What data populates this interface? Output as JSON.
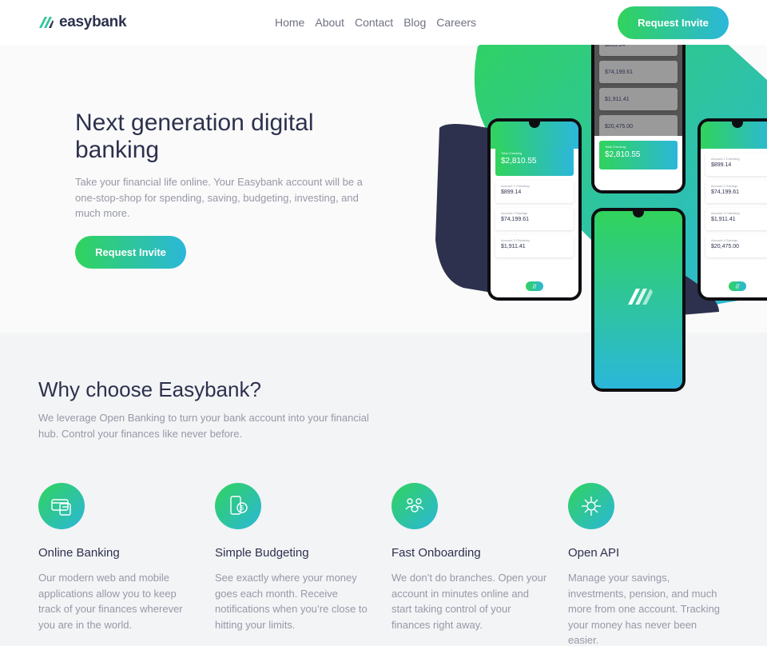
{
  "header": {
    "logo_text": "easybank",
    "nav": [
      "Home",
      "About",
      "Contact",
      "Blog",
      "Careers"
    ],
    "cta": "Request Invite"
  },
  "hero": {
    "title": "Next generation digital banking",
    "text": "Take your financial life online. Your Easybank account will be a one-stop-shop for spending, saving, budgeting, investing, and much more.",
    "cta": "Request Invite"
  },
  "phones": {
    "total_label": "Total Checking",
    "total_value": "$2,810.55",
    "accounts": [
      {
        "label": "Account 1 Checking",
        "value": "$899.14"
      },
      {
        "label": "Account 2 Savings",
        "value": "$74,199.61"
      },
      {
        "label": "Account 3 Checking",
        "value": "$1,911.41"
      },
      {
        "label": "Account 4 Savings",
        "value": "$20,475.00"
      }
    ]
  },
  "features": {
    "title": "Why choose Easybank?",
    "text": "We leverage Open Banking to turn your bank account into your financial hub. Control your finances like never before.",
    "items": [
      {
        "title": "Online Banking",
        "text": "Our modern web and mobile applications allow you to keep track of your finances wherever you are in the world.",
        "icon": "online-banking-icon"
      },
      {
        "title": "Simple Budgeting",
        "text": "See exactly where your money goes each month. Receive notifications when you’re close to hitting your limits.",
        "icon": "budgeting-icon"
      },
      {
        "title": "Fast Onboarding",
        "text": "We don’t do branches. Open your account in minutes online and start taking control of your finances right away.",
        "icon": "onboarding-icon"
      },
      {
        "title": "Open API",
        "text": "Manage your savings, investments, pension, and much more from one account. Tracking your money has never been easier.",
        "icon": "api-icon"
      }
    ]
  },
  "colors": {
    "dark_blue": "#2d314d",
    "lime_green": "#31d35c",
    "bright_cyan": "#2bb7da",
    "grayish_blue": "#9698a6"
  }
}
